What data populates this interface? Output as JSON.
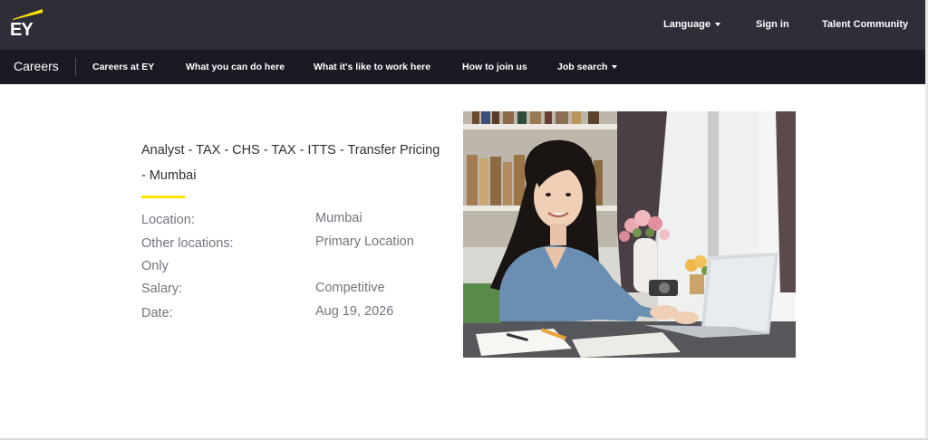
{
  "header": {
    "logo_text": "EY",
    "language_label": "Language",
    "sign_in_label": "Sign in",
    "talent_community_label": "Talent Community"
  },
  "nav": {
    "careers_label": "Careers",
    "items": [
      "Careers at EY",
      "What you can do here",
      "What it's like to work here",
      "How to join us",
      "Job search"
    ]
  },
  "job": {
    "title_line1": "Analyst - TAX - CHS - TAX - ITTS - Transfer Pricing",
    "title_line2": "- Mumbai",
    "location_label": "Location:",
    "location_value": "Mumbai",
    "other_locations_label": "Other locations:",
    "other_locations_value": "Primary Location",
    "other_locations_cont": "Only",
    "salary_label": "Salary:",
    "salary_value": "Competitive",
    "date_label": "Date:",
    "date_value": "Aug 19, 2026"
  },
  "colors": {
    "topbar": "#2e2e38",
    "navbar": "#1a1a24",
    "accent": "#ffe600",
    "muted_text": "#747480"
  }
}
